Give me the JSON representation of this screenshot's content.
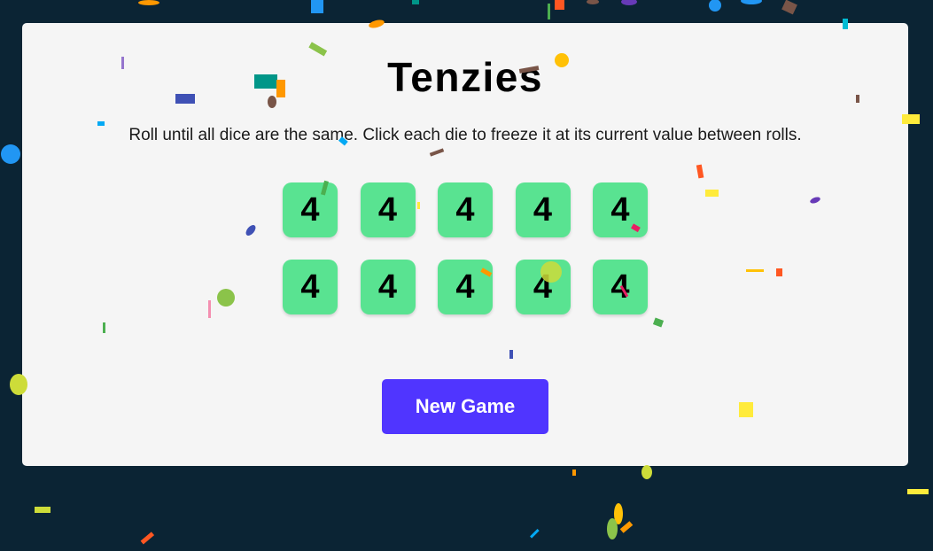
{
  "app": {
    "title": "Tenzies",
    "instructions": "Roll until all dice are the same. Click each die to freeze it at its current value between rolls.",
    "button_label": "New Game",
    "colors": {
      "background": "#0b2434",
      "card": "#f5f5f5",
      "die_held": "#59e391",
      "button": "#5035ff"
    }
  },
  "dice": [
    {
      "value": "4",
      "held": true
    },
    {
      "value": "4",
      "held": true
    },
    {
      "value": "4",
      "held": true
    },
    {
      "value": "4",
      "held": true
    },
    {
      "value": "4",
      "held": true
    },
    {
      "value": "4",
      "held": true
    },
    {
      "value": "4",
      "held": true
    },
    {
      "value": "4",
      "held": true
    },
    {
      "value": "4",
      "held": true
    },
    {
      "value": "4",
      "held": true
    }
  ],
  "game_state": {
    "won": true,
    "confetti": true
  }
}
